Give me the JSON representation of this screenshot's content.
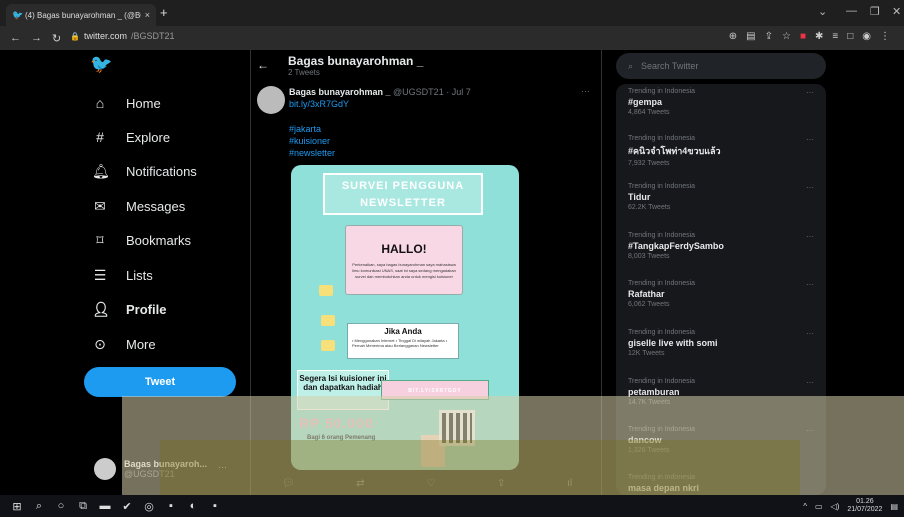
{
  "browser": {
    "tab_title": "(4) Bagas bunayarohman _ (@BG",
    "tab_close": "×",
    "new_tab": "+",
    "url_host": "twitter.com",
    "url_path": "/BGSDT21",
    "win_min": "—",
    "win_max": "❐",
    "win_close": "✕",
    "win_chevron": "⌄"
  },
  "nav": {
    "items": [
      {
        "label": "Home",
        "icon": "home-icon"
      },
      {
        "label": "Explore",
        "icon": "hashtag-icon"
      },
      {
        "label": "Notifications",
        "icon": "bell-icon"
      },
      {
        "label": "Messages",
        "icon": "mail-icon"
      },
      {
        "label": "Bookmarks",
        "icon": "bookmark-icon"
      },
      {
        "label": "Lists",
        "icon": "list-icon"
      },
      {
        "label": "Profile",
        "icon": "person-icon"
      },
      {
        "label": "More",
        "icon": "more-circle-icon"
      }
    ],
    "tweet_button": "Tweet",
    "account_name": "Bagas bunayaroh...",
    "account_handle": "@UGSDT21"
  },
  "profile_header": {
    "name": "Bagas bunayarohman _",
    "tweet_count": "2 Tweets"
  },
  "tweet": {
    "author": "Bagas bunayarohman _",
    "meta": "@UGSDT21 · Jul 7",
    "link": "bit.ly/3xR7GdY",
    "hashtags": [
      "#jakarta",
      "#kuisioner",
      "#newsletter"
    ]
  },
  "poster": {
    "title": "SURVEI PENGGUNA NEWSLETTER",
    "hallo": "HALLO!",
    "hallo_text": "Perkenalkan, saya bagas bunayarohman saya mahasiswa ilmu komunikasi UNAS, saat ini saya sedang mengadakan survei dan membutuhkan anda untuk mengisi kuisioner",
    "jika_title": "Jika Anda",
    "jika_items": "• Menggunakan Internet • Tinggal Di wilayah Jakarta • Pernah Menerima atau Berlangganan Newsletter",
    "segera": "Segera Isi kuisioner ini dan dapatkan hadiah",
    "reward": "RP 50.000",
    "bagi": "Bagi 6 orang Pemenang",
    "link_box": "BIT.LY/3XR7GDY"
  },
  "trends": {
    "search_placeholder": "Search Twitter",
    "items": [
      {
        "cat": "Trending in Indonesia",
        "name": "#gempa",
        "count": "4,864 Tweets"
      },
      {
        "cat": "Trending in Indonesia",
        "name": "#คนิวจำโพท่า4ขวบแล้ว",
        "count": "7,932 Tweets"
      },
      {
        "cat": "Trending in Indonesia",
        "name": "Tidur",
        "count": "62.2K Tweets"
      },
      {
        "cat": "Trending in Indonesia",
        "name": "#TangkapFerdySambo",
        "count": "8,003 Tweets"
      },
      {
        "cat": "Trending in Indonesia",
        "name": "Rafathar",
        "count": "6,062 Tweets"
      },
      {
        "cat": "Trending in Indonesia",
        "name": "giselle live with somi",
        "count": "12K Tweets"
      },
      {
        "cat": "Trending in Indonesia",
        "name": "petamburan",
        "count": "14.7K Tweets"
      },
      {
        "cat": "Trending in Indonesia",
        "name": "dancow",
        "count": "1,326 Tweets"
      },
      {
        "cat": "Trending in Indonesia",
        "name": "masa depan nkri",
        "count": ""
      }
    ]
  },
  "taskbar": {
    "time": "01.26",
    "date": "21/07/2022"
  }
}
